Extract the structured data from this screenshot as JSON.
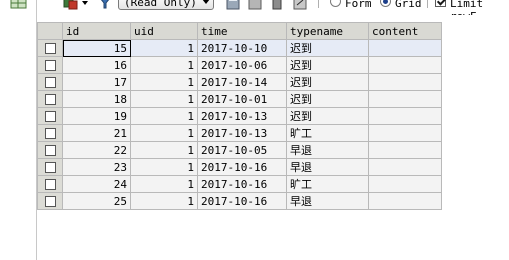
{
  "toolbar": {
    "mode_select": "(Read Only)",
    "view_options": [
      {
        "label": "Form",
        "selected": false
      },
      {
        "label": "Grid",
        "selected": true
      }
    ],
    "limit_rows_label": "Limit rowF",
    "limit_rows_checked": true
  },
  "grid": {
    "columns": [
      "id",
      "uid",
      "time",
      "typename",
      "content"
    ],
    "rows": [
      {
        "id": "15",
        "uid": "1",
        "time": "2017-10-10",
        "typename": "迟到",
        "content": ""
      },
      {
        "id": "16",
        "uid": "1",
        "time": "2017-10-06",
        "typename": "迟到",
        "content": ""
      },
      {
        "id": "17",
        "uid": "1",
        "time": "2017-10-14",
        "typename": "迟到",
        "content": ""
      },
      {
        "id": "18",
        "uid": "1",
        "time": "2017-10-01",
        "typename": "迟到",
        "content": ""
      },
      {
        "id": "19",
        "uid": "1",
        "time": "2017-10-13",
        "typename": "迟到",
        "content": ""
      },
      {
        "id": "21",
        "uid": "1",
        "time": "2017-10-13",
        "typename": "旷工",
        "content": ""
      },
      {
        "id": "22",
        "uid": "1",
        "time": "2017-10-05",
        "typename": "早退",
        "content": ""
      },
      {
        "id": "23",
        "uid": "1",
        "time": "2017-10-16",
        "typename": "早退",
        "content": ""
      },
      {
        "id": "24",
        "uid": "1",
        "time": "2017-10-16",
        "typename": "旷工",
        "content": ""
      },
      {
        "id": "25",
        "uid": "1",
        "time": "2017-10-16",
        "typename": "早退",
        "content": ""
      }
    ]
  }
}
